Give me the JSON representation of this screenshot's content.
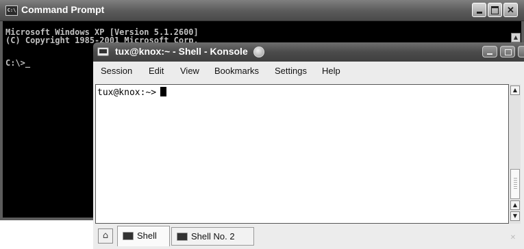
{
  "cmd": {
    "title": "Command Prompt",
    "icon": "console-icon",
    "icon_text": "C:\\",
    "output_lines": "Microsoft Windows XP [Version 5.1.2600]\n(C) Copyright 1985-2001 Microsoft Corp.",
    "prompt": "C:\\>_",
    "scroll_up": "▲"
  },
  "konsole": {
    "title": "tux@knox:~ - Shell - Konsole",
    "menu": [
      "Session",
      "Edit",
      "View",
      "Bookmarks",
      "Settings",
      "Help"
    ],
    "terminal": {
      "prompt": "tux@knox:~>"
    },
    "scrollbar": {
      "up": "▲",
      "down": "▼"
    },
    "tabs": [
      {
        "label": "Shell",
        "icon": "terminal-icon",
        "active": true
      },
      {
        "label": "Shell No. 2",
        "icon": "terminal-icon",
        "active": false
      }
    ],
    "new_tab_icon": "new-session-icon",
    "close_tab_icon": "close-session-icon",
    "new_tab_glyph": "⌂",
    "close_tab_glyph": "✕"
  },
  "colors": {
    "cmd_console_bg": "#000000",
    "cmd_text": "#c0c0c0",
    "titlebar": "#4b4b4b",
    "konsole_terminal_bg": "#ffffff"
  }
}
